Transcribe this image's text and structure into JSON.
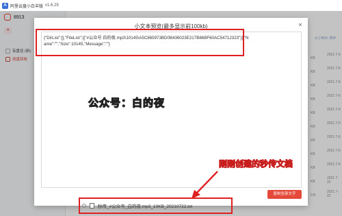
{
  "window": {
    "logo": "A",
    "title": "阿里云盘小白羊版",
    "version": "v1.6.29"
  },
  "sidebar": {
    "user_id": "8913",
    "tab_label": "A",
    "items": [
      {
        "label": "有盘径 (新)"
      },
      {
        "label": "用盘回收"
      }
    ]
  },
  "background_list": {
    "header": "从小到大 排序",
    "rows": [
      {
        "size": "KB",
        "date": "2021 7-6"
      },
      {
        "size": "KB",
        "date": "2021 7-6"
      },
      {
        "size": "KB",
        "date": "2021 7-6"
      },
      {
        "size": "KB",
        "date": "2021 7-6"
      },
      {
        "size": "KB",
        "date": "2021 7-6"
      },
      {
        "size": "KB",
        "date": "2021 7-6"
      },
      {
        "size": "KB",
        "date": "2021 7-6"
      },
      {
        "size": "KB",
        "date": "2021 7-6"
      },
      {
        "size": "KB",
        "date": "2021 7-6"
      },
      {
        "size": "KB",
        "date": "2021 7-22"
      },
      {
        "size": "0 B",
        "date": "2021 7-22"
      }
    ]
  },
  "modal": {
    "title": "小文本预览(最多显示前100kb)",
    "close_symbol": "×",
    "content": "{\"DirList\":[],\"FileList\":[{\"#公众号 白的夜.mp3\\10145\\A5C865973BD0B436023E217B86BF60AC54712323\"}],\"Name\":\"\",\"Size\":10145,\"Message\":\"\"}",
    "watermark": "公众号：白的夜",
    "copy_button": "复制全部文字"
  },
  "annotation": {
    "text": "刚刚创建的秒传文档"
  },
  "file_row": {
    "name": "秒传_#公众号_白的夜.mp3_10KB_20210722.txt"
  },
  "colors": {
    "accent": "#e4493a",
    "annotation_red": "#e02020"
  }
}
